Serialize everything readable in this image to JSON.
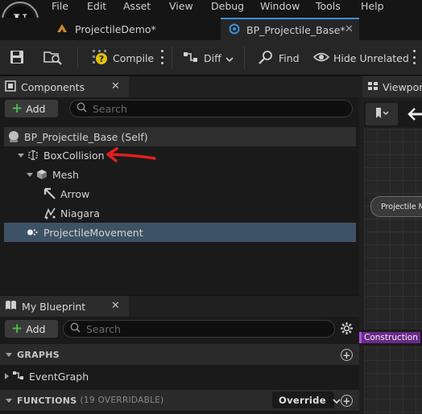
{
  "menu": {
    "items": [
      "File",
      "Edit",
      "Asset",
      "View",
      "Debug",
      "Window",
      "Tools",
      "Help"
    ]
  },
  "tabs": [
    {
      "label": "ProjectileDemo*",
      "active": false
    },
    {
      "label": "BP_Projectile_Base*",
      "active": true
    }
  ],
  "toolbar": {
    "compile_label": "Compile",
    "diff_label": "Diff",
    "find_label": "Find",
    "hide_unrelated_label": "Hide Unrelated"
  },
  "components_panel": {
    "title": "Components",
    "add_label": "Add",
    "search_placeholder": "Search",
    "tree": [
      {
        "label": "BP_Projectile_Base (Self)",
        "icon": "self-icon"
      },
      {
        "label": "BoxCollision",
        "icon": "box-collision-icon"
      },
      {
        "label": "Mesh",
        "icon": "cube-icon"
      },
      {
        "label": "Arrow",
        "icon": "arrow-icon"
      },
      {
        "label": "Niagara",
        "icon": "niagara-icon"
      },
      {
        "label": "ProjectileMovement",
        "icon": "projectile-movement-icon"
      }
    ]
  },
  "blueprint_panel": {
    "title": "My Blueprint",
    "add_label": "Add",
    "search_placeholder": "Search",
    "graphs_label": "GRAPHS",
    "event_graph_label": "EventGraph",
    "functions_label": "FUNCTIONS",
    "functions_count": "(19 OVERRIDABLE)",
    "override_label": "Override"
  },
  "viewport": {
    "tab_label": "Viewport",
    "node_label": "Projectile Movement",
    "construction_label": "Construction Script"
  },
  "colors": {
    "accent_blue": "#3a8fd8",
    "selection": "#3e5266",
    "annotation_red": "#e0201e",
    "add_green": "#4cb84c"
  }
}
